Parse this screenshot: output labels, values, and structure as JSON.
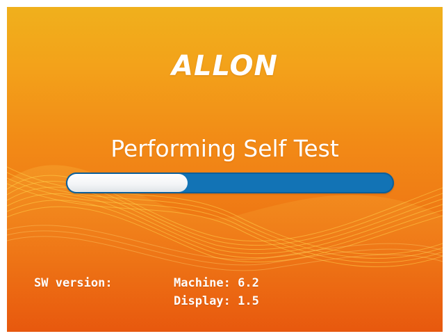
{
  "brand": {
    "logo_text": "ALLON"
  },
  "status": {
    "message": "Performing Self Test"
  },
  "progress": {
    "fraction": 0.37
  },
  "software": {
    "label": "SW version:",
    "machine": "Machine: 6.2",
    "display": "Display: 1.5"
  },
  "colors": {
    "background_top": "#f0b01c",
    "background_bottom": "#e8580e",
    "progress_track": "#1273b5",
    "progress_fill": "#ffffff",
    "text": "#ffffff"
  }
}
